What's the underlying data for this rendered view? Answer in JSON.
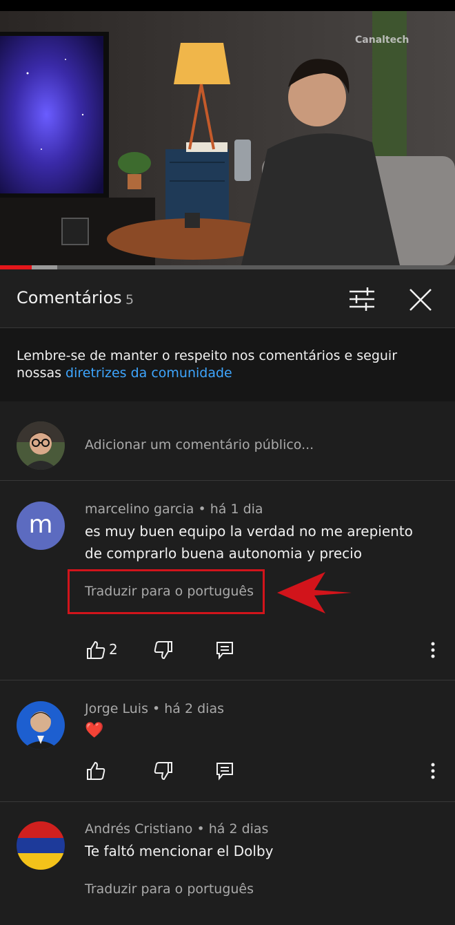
{
  "video": {
    "watermark": "Canaltech"
  },
  "header": {
    "title": "Comentários",
    "count": "5"
  },
  "notice": {
    "text": "Lembre-se de manter o respeito nos comentários e seguir nossas ",
    "link": "diretrizes da comunidade"
  },
  "add_comment": {
    "placeholder": "Adicionar um comentário público..."
  },
  "comments": [
    {
      "author": "marcelino garcia",
      "time": "há 1 dia",
      "avatar_letter": "m",
      "text": "es muy buen equipo la verdad no me arepiento de comprarlo buena autonomia y  precio",
      "translate": "Traduzir para o português",
      "likes": "2"
    },
    {
      "author": "Jorge Luis",
      "time": "há 2 dias",
      "text": "❤️",
      "likes": ""
    },
    {
      "author": "Andrés Cristiano",
      "time": "há 2 dias",
      "text": "Te faltó mencionar el Dolby",
      "translate": "Traduzir para o português"
    }
  ],
  "colors": {
    "accent_link": "#3ea6ff",
    "progress": "#e4161b",
    "annotation": "#d2141b"
  },
  "progress": {
    "played_fraction": 0.07,
    "buffered_fraction": 0.125
  }
}
